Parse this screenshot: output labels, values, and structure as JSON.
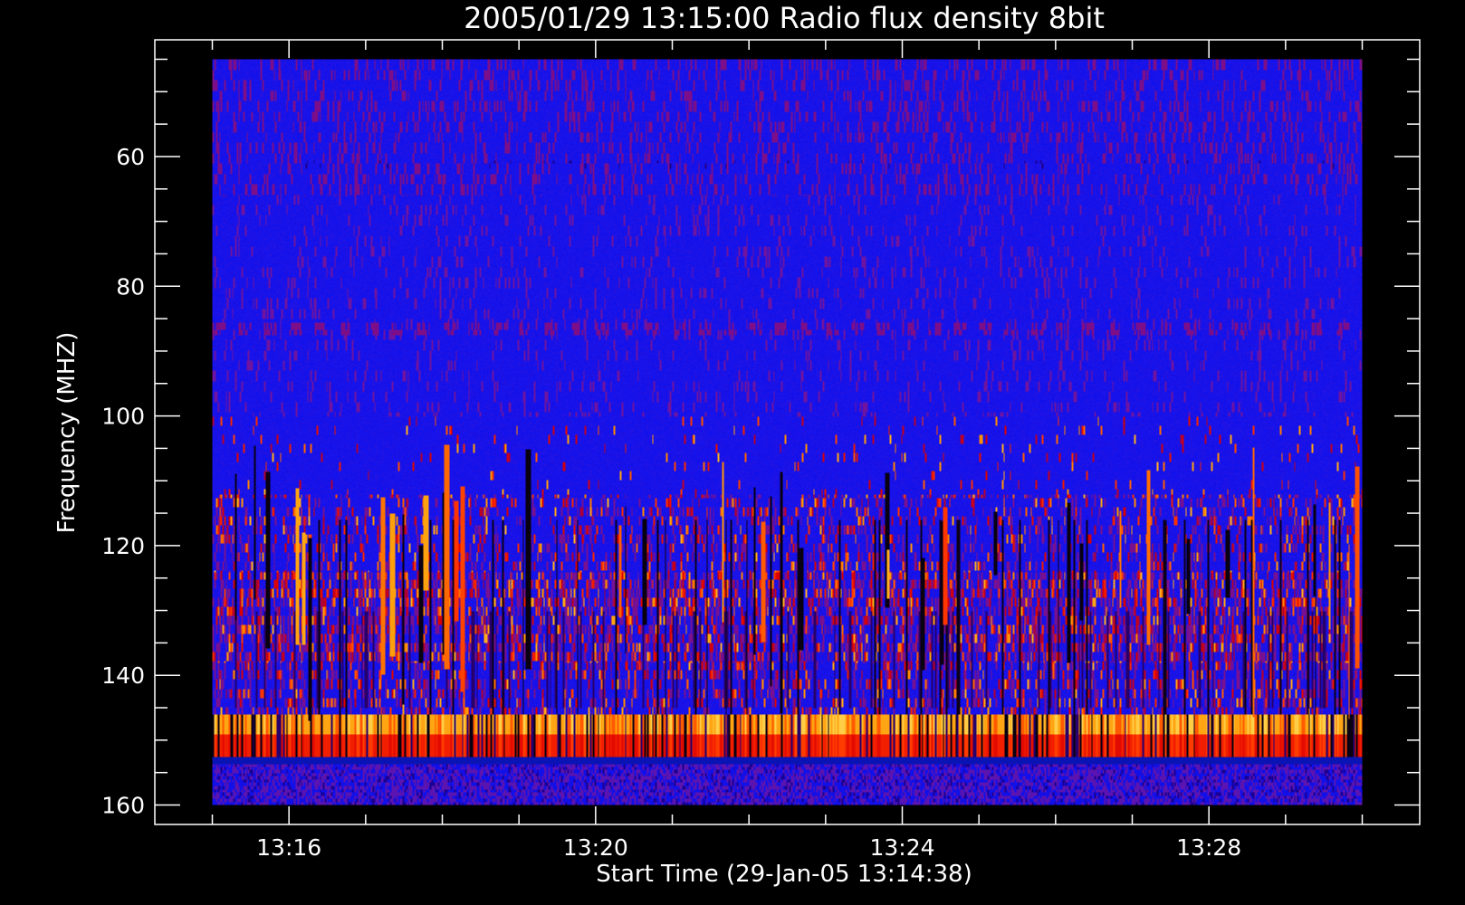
{
  "chart_data": {
    "type": "heatmap",
    "title": "2005/01/29 13:15:00 Radio flux density 8bit",
    "xlabel": "Start Time (29-Jan-05 13:14:38)",
    "ylabel": "Frequency (MHZ)",
    "x_range": [
      "13:15:00",
      "13:30:00"
    ],
    "x_axis_range": [
      "13:14:15",
      "13:30:45"
    ],
    "xlim_minutes_from_13_00": [
      14.25,
      30.75
    ],
    "y_range": [
      45,
      160
    ],
    "ylim": [
      42,
      163
    ],
    "y_inverted": true,
    "x_major_ticks": [
      {
        "label": "13:16",
        "minutes": 16
      },
      {
        "label": "13:20",
        "minutes": 20
      },
      {
        "label": "13:24",
        "minutes": 24
      },
      {
        "label": "13:28",
        "minutes": 28
      }
    ],
    "x_minor_tick_minutes": [
      15,
      17,
      18,
      19,
      21,
      22,
      23,
      25,
      26,
      27,
      29,
      30
    ],
    "y_major_ticks": [
      60,
      80,
      100,
      120,
      140,
      160
    ],
    "y_minor_tick_step": 5,
    "colormap": [
      "#000000",
      "#3a0060",
      "#0000ff",
      "#8a1a9a",
      "#d40000",
      "#ff2a00",
      "#ff8c00",
      "#ffc83c",
      "#ffff80"
    ],
    "background_color": "#1414ee",
    "features": [
      {
        "kind": "band",
        "freq": [
          146,
          152
        ],
        "intensity": "strong",
        "pattern": "alternating black/red/orange stripes"
      },
      {
        "kind": "band",
        "freq": [
          113,
          145
        ],
        "intensity": "moderate",
        "pattern": "scattered red/orange bursts"
      },
      {
        "kind": "band",
        "freq": [
          86,
          88
        ],
        "intensity": "weak",
        "pattern": "dashed purple line"
      },
      {
        "kind": "band",
        "freq": [
          61,
          62
        ],
        "intensity": "weak",
        "pattern": "dark blue segments"
      },
      {
        "kind": "band",
        "freq": [
          153,
          160
        ],
        "intensity": "weak",
        "pattern": "purple vertical striping"
      }
    ],
    "grid": false,
    "legend": "none"
  }
}
